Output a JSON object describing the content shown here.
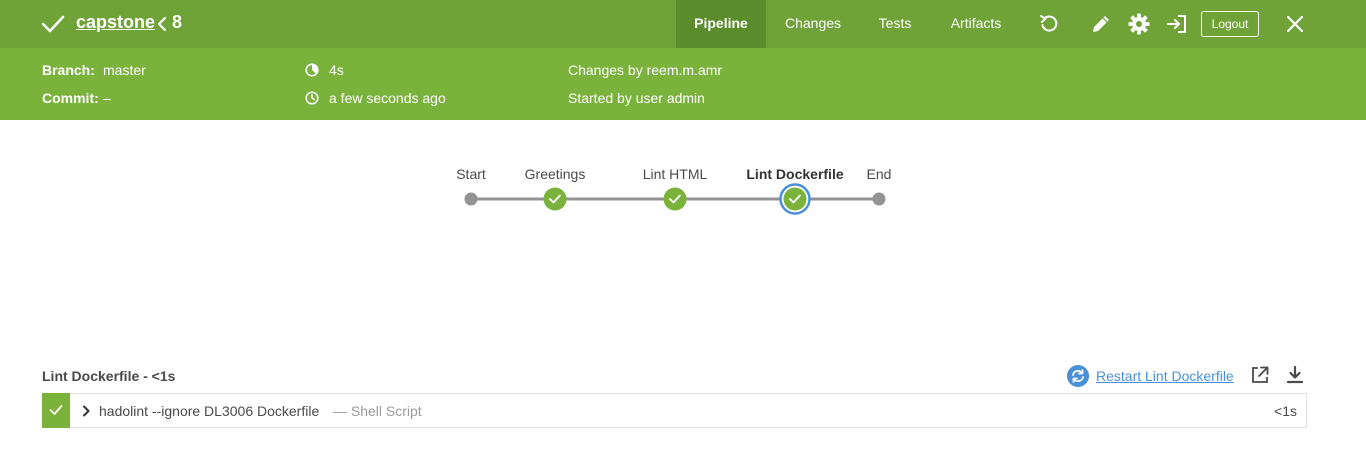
{
  "header": {
    "job_name": "capstone",
    "run_number": "8",
    "tabs": [
      {
        "label": "Pipeline",
        "active": true
      },
      {
        "label": "Changes",
        "active": false
      },
      {
        "label": "Tests",
        "active": false
      },
      {
        "label": "Artifacts",
        "active": false
      }
    ],
    "icons": [
      "replay-icon",
      "edit-icon",
      "gear-icon",
      "exit-icon",
      "close-icon"
    ],
    "logout_label": "Logout",
    "color": "#6fa337",
    "active_tab_color": "#5b8c2b"
  },
  "run_info": {
    "branch_label": "Branch:",
    "branch_value": "master",
    "commit_label": "Commit:",
    "commit_value": "–",
    "duration": "4s",
    "started_ago": "a few seconds ago",
    "changes": "Changes by reem.m.amr",
    "started_by": "Started by user admin",
    "color": "#7ab23c"
  },
  "pipeline": {
    "stages": [
      {
        "label": "Start",
        "kind": "endpoint",
        "status": "none",
        "selected": false
      },
      {
        "label": "Greetings",
        "kind": "stage",
        "status": "success",
        "selected": false
      },
      {
        "label": "Lint HTML",
        "kind": "stage",
        "status": "success",
        "selected": false
      },
      {
        "label": "Lint Dockerfile",
        "kind": "stage",
        "status": "success",
        "selected": true
      },
      {
        "label": "End",
        "kind": "endpoint",
        "status": "none",
        "selected": false
      }
    ],
    "success_color": "#7ab23c",
    "selected_ring_color": "#4a90d9"
  },
  "step_panel": {
    "title": "Lint Dockerfile - <1s",
    "restart_label": "Restart Lint Dockerfile",
    "steps": [
      {
        "command": "hadolint --ignore DL3006 Dockerfile",
        "type": "— Shell Script",
        "duration": "<1s",
        "status": "success"
      }
    ]
  }
}
